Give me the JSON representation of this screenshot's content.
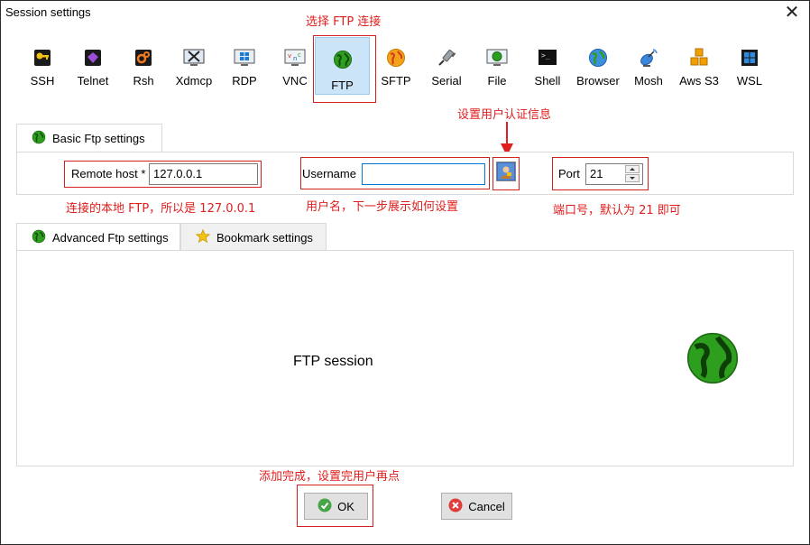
{
  "window": {
    "title": "Session settings",
    "close_glyph": "✕"
  },
  "protocols": [
    {
      "label": "SSH",
      "icon": "key-icon"
    },
    {
      "label": "Telnet",
      "icon": "gem-icon"
    },
    {
      "label": "Rsh",
      "icon": "gears-icon"
    },
    {
      "label": "Xdmcp",
      "icon": "x-screen-icon"
    },
    {
      "label": "RDP",
      "icon": "windows-monitor-icon"
    },
    {
      "label": "VNC",
      "icon": "vnc-monitor-icon"
    },
    {
      "label": "FTP",
      "icon": "globe-icon",
      "selected": true
    },
    {
      "label": "SFTP",
      "icon": "orange-globe-icon"
    },
    {
      "label": "Serial",
      "icon": "plug-icon"
    },
    {
      "label": "File",
      "icon": "file-monitor-icon"
    },
    {
      "label": "Shell",
      "icon": "terminal-icon"
    },
    {
      "label": "Browser",
      "icon": "browser-globe-icon"
    },
    {
      "label": "Mosh",
      "icon": "satellite-icon"
    },
    {
      "label": "Aws S3",
      "icon": "cubes-icon"
    },
    {
      "label": "WSL",
      "icon": "windows-logo-icon"
    }
  ],
  "annotations": {
    "select_ftp": "选择 FTP 连接",
    "set_user_auth": "设置用户认证信息",
    "local_host_note": "连接的本地 FTP，所以是 127.0.0.1",
    "username_note": "用户名，下一步展示如何设置",
    "port_note": "端口号，默认为 21 即可",
    "finish_note": "添加完成，设置完用户再点"
  },
  "basic": {
    "tab_label": "Basic Ftp settings",
    "remote_host_label": "Remote host *",
    "remote_host_value": "127.0.0.1",
    "username_label": "Username",
    "username_value": "",
    "port_label": "Port",
    "port_value": "21"
  },
  "advanced": {
    "tab_label": "Advanced Ftp settings",
    "bookmark_tab_label": "Bookmark settings",
    "session_title": "FTP session"
  },
  "buttons": {
    "ok": "OK",
    "cancel": "Cancel"
  },
  "colors": {
    "accent_red": "#e01e1e",
    "selection": "#cce4f7",
    "globe_green": "#2e9e1f"
  }
}
